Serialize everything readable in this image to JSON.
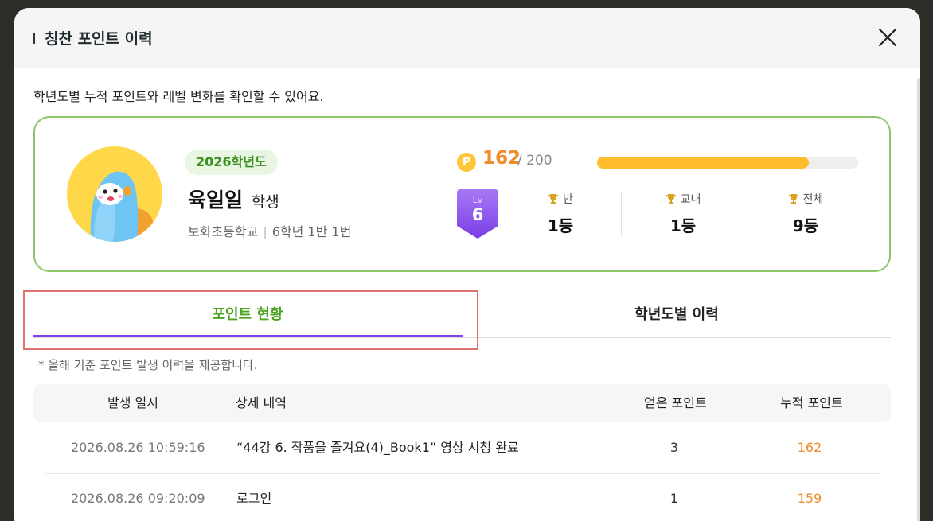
{
  "modal": {
    "title": "칭찬 포인트 이력",
    "description": "학년도별 누적 포인트와 레벨 변화를 확인할 수 있어요."
  },
  "profile": {
    "year": "2026학년도",
    "name": "육일일",
    "suffix": "학생",
    "school": "보화초등학교",
    "class_info": "6학년 1반 1번",
    "point_icon": "P",
    "points": "162",
    "max_points": "/ 200",
    "progress_fraction": 0.81,
    "level_label": "Lv",
    "level_value": "6",
    "ranks": [
      {
        "label": "반",
        "value": "1등"
      },
      {
        "label": "교내",
        "value": "1등"
      },
      {
        "label": "전체",
        "value": "9등"
      }
    ]
  },
  "tabs": [
    {
      "label": "포인트 현황",
      "active": true
    },
    {
      "label": "학년도별 이력",
      "active": false
    }
  ],
  "note": "* 올해 기준 포인트 발생 이력을 제공합니다.",
  "table": {
    "headers": [
      "발생 일시",
      "상세 내역",
      "얻은 포인트",
      "누적 포인트"
    ],
    "rows": [
      {
        "date": "2026.08.26 10:59:16",
        "detail": "“44강 6. 작품을 즐겨요(4)_Book1” 영상 시청 완료",
        "earned": "3",
        "total": "162"
      },
      {
        "date": "2026.08.26 09:20:09",
        "detail": "로그인",
        "earned": "1",
        "total": "159"
      }
    ]
  },
  "colors": {
    "accent_green": "#4aa320",
    "tab_underline": "#7b46e6",
    "points_orange": "#f08c2a",
    "progress": "#ffbd2e",
    "level_purple": "#8b4fe8",
    "card_border": "#8cc66b"
  },
  "icons": [
    "close-icon",
    "avatar-character",
    "point-coin-icon",
    "level-badge-icon",
    "trophy-icon"
  ]
}
